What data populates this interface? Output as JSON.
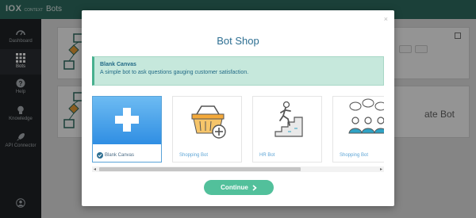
{
  "topbar": {
    "logo_main": "IOX",
    "logo_sub": "CONTEXT",
    "title": "Bots"
  },
  "sidebar": {
    "items": [
      {
        "label": "Dashboard",
        "icon": "speedometer-icon"
      },
      {
        "label": "Bots",
        "icon": "grid-icon",
        "active": true
      },
      {
        "label": "Help",
        "icon": "question-icon"
      },
      {
        "label": "Knowledge",
        "icon": "lightbulb-icon"
      },
      {
        "label": "API Connector",
        "icon": "rocket-icon"
      }
    ],
    "user_icon": "user-avatar-icon"
  },
  "background": {
    "partial_text": "ate Bot",
    "partial_dot": "t"
  },
  "modal": {
    "close": "×",
    "title": "Bot Shop",
    "info": {
      "title": "Blank Canvas",
      "description": "A simple bot to ask questions gauging customer satisfaction."
    },
    "cards": [
      {
        "label": "Blank Canvas",
        "icon": "plus-icon",
        "selected": true
      },
      {
        "label": "Shopping Bot",
        "icon": "shopping-basket-icon"
      },
      {
        "label": "HR Bot",
        "icon": "climbing-stairs-icon"
      },
      {
        "label": "Shopping Bot",
        "icon": "people-chat-icon"
      }
    ],
    "continue_label": "Continue",
    "continue_icon": "chevron-right-icon"
  },
  "colors": {
    "topbar": "#2f6f63",
    "sidebar": "#1f2326",
    "accent": "#52c09b",
    "title": "#2e6f92",
    "info_bg": "#c6e8dc"
  }
}
